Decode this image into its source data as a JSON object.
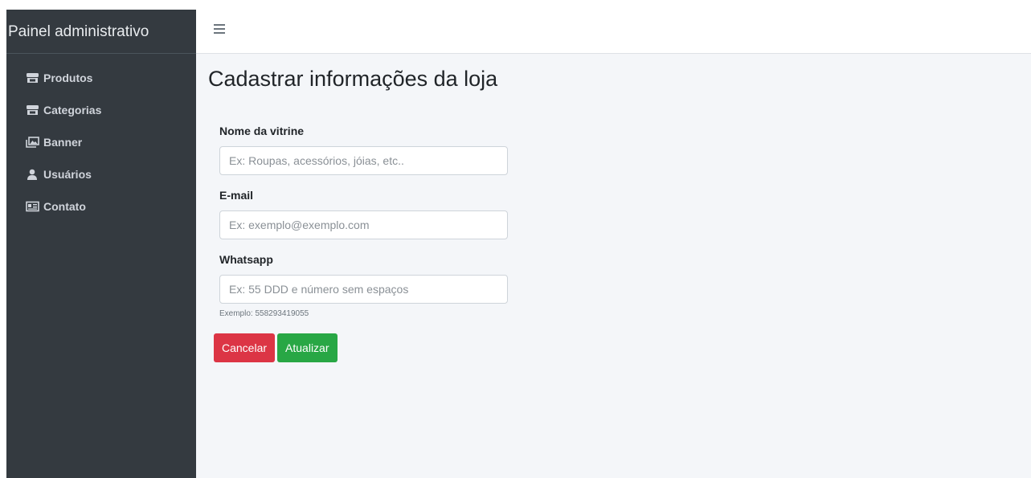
{
  "sidebar": {
    "brand": "Painel administrativo",
    "items": [
      {
        "label": "Produtos",
        "icon": "store-icon"
      },
      {
        "label": "Categorias",
        "icon": "store-icon"
      },
      {
        "label": "Banner",
        "icon": "image-icon"
      },
      {
        "label": "Usuários",
        "icon": "user-icon"
      },
      {
        "label": "Contato",
        "icon": "contact-card-icon"
      }
    ]
  },
  "topbar": {
    "menu_icon": "hamburger-menu-icon"
  },
  "main": {
    "title": "Cadastrar informações da loja",
    "form": {
      "vitrine_label": "Nome da vitrine",
      "vitrine_placeholder": "Ex: Roupas, acessórios, jóias, etc..",
      "vitrine_value": "",
      "email_label": "E-mail",
      "email_placeholder": "Ex: exemplo@exemplo.com",
      "email_value": "",
      "whatsapp_label": "Whatsapp",
      "whatsapp_placeholder": "Ex: 55 DDD e número sem espaços",
      "whatsapp_value": "",
      "whatsapp_help": "Exemplo: 558293419055"
    },
    "buttons": {
      "cancel_label": "Cancelar",
      "update_label": "Atualizar"
    }
  },
  "colors": {
    "sidebar_bg": "#343a40",
    "content_bg": "#f4f6f9",
    "danger": "#dc3545",
    "success": "#28a745"
  }
}
